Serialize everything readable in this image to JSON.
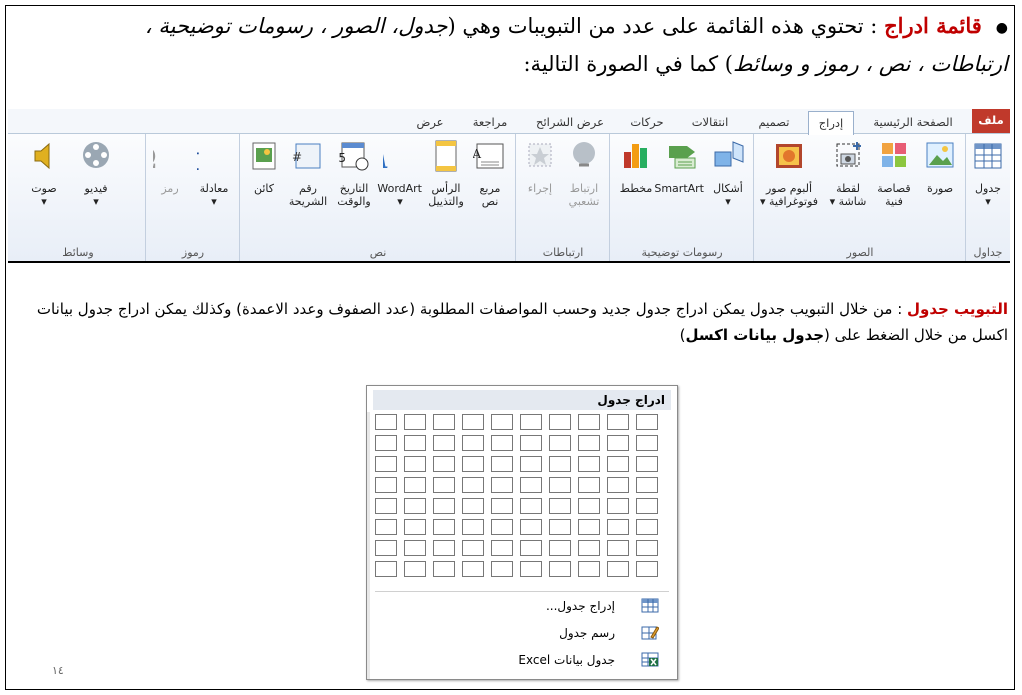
{
  "intro": {
    "bullet": "●",
    "keyword": "قائمة ادراج",
    "text_1": " : تحتوي هذه القائمة على عدد من التبويبات وهي (",
    "items_italic": "جدول، الصور ، رسومات توضيحية ،",
    "text_2": " ",
    "items_italic_2": "ارتباطات ، نص ، رموز و وسائط",
    "text_3": ") كما في الصورة التالية:"
  },
  "ribbon": {
    "tabs": [
      "ملف",
      "الصفحة الرئيسية",
      "إدراج",
      "تصميم",
      "انتقالات",
      "حركات",
      "عرض الشرائح",
      "مراجعة",
      "عرض"
    ],
    "groups": [
      {
        "label": "جداول",
        "items": [
          {
            "label": "جدول\n▾",
            "icon": "table-icon"
          }
        ]
      },
      {
        "label": "الصور",
        "items": [
          {
            "label": "صورة",
            "icon": "picture-icon"
          },
          {
            "label": "قصاصة\nفنية",
            "icon": "clipart-icon"
          },
          {
            "label": "لقطة\nشاشة ▾",
            "icon": "screenshot-icon"
          },
          {
            "label": "ألبوم صور\nفوتوغرافية ▾",
            "icon": "photo-album-icon"
          }
        ]
      },
      {
        "label": "رسومات توضيحية",
        "items": [
          {
            "label": "أشكال\n▾",
            "icon": "shapes-icon"
          },
          {
            "label": "SmartArt",
            "icon": "smartart-icon"
          },
          {
            "label": "مخطط",
            "icon": "chart-icon"
          }
        ]
      },
      {
        "label": "ارتباطات",
        "items": [
          {
            "label": "ارتباط\nتشعبي",
            "icon": "hyperlink-icon"
          },
          {
            "label": "إجراء",
            "icon": "action-icon"
          }
        ]
      },
      {
        "label": "نص",
        "items": [
          {
            "label": "مربع\nنص",
            "icon": "textbox-icon"
          },
          {
            "label": "الرأس\nوالتذييل",
            "icon": "header-footer-icon"
          },
          {
            "label": "WordArt\n▾",
            "icon": "wordart-icon"
          },
          {
            "label": "التاريخ\nوالوقت",
            "icon": "date-time-icon"
          },
          {
            "label": "رقم\nالشريحة",
            "icon": "slide-number-icon"
          },
          {
            "label": "كائن",
            "icon": "object-icon"
          }
        ]
      },
      {
        "label": "رموز",
        "items": [
          {
            "label": "معادلة\n▾",
            "icon": "equation-icon"
          },
          {
            "label": "رمز",
            "icon": "symbol-icon"
          }
        ]
      },
      {
        "label": "وسائط",
        "items": [
          {
            "label": "فيديو\n▾",
            "icon": "video-icon"
          },
          {
            "label": "صوت\n▾",
            "icon": "audio-icon"
          }
        ]
      }
    ]
  },
  "para": {
    "keyword": "التبويب جدول",
    "text_1": " : من خلال التبويب جدول يمكن ادراج جدول جديد وحسب المواصفات المطلوبة (عدد الصفوف وعدد الاعمدة) وكذلك يمكن ادراج جدول بيانات اكسل من خلال الضغط على (",
    "bold": "جدول بيانات اكسل",
    "text_2": ")"
  },
  "popup": {
    "title": "ادراج جدول",
    "menu": [
      {
        "label": "إدراج جدول...",
        "icon": "insert-table-icon"
      },
      {
        "label": "رسم جدول",
        "icon": "draw-table-icon"
      },
      {
        "label": "جدول بيانات Excel",
        "icon": "excel-sheet-icon"
      }
    ]
  },
  "page_number": "١٤",
  "colors": {
    "accent_red": "#c00000",
    "file_tab": "#c0392b"
  }
}
